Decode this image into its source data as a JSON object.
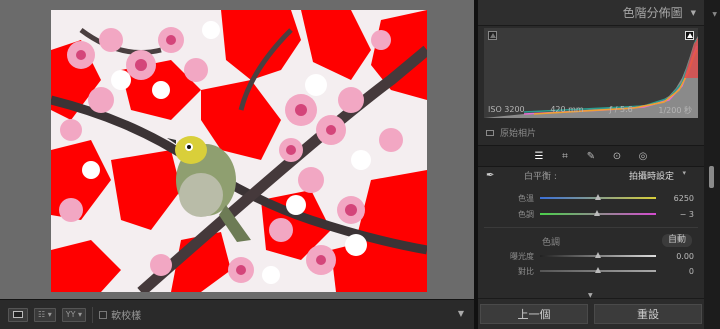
{
  "panel": {
    "title": "色階分佈圖",
    "collapse_icon": "triangle-down-icon"
  },
  "histogram": {
    "iso": "ISO 3200",
    "focal_length": "420 mm",
    "aperture": "ƒ / 5.6",
    "shutter": "1/200 秒",
    "original_photo_label": "原始相片"
  },
  "tools": [
    "sliders-icon",
    "crop-icon",
    "brush-icon",
    "redeye-icon",
    "radial-icon"
  ],
  "basic": {
    "white_balance_label": "白平衡 :",
    "white_balance_value": "拍攝時設定",
    "temp_label": "色溫",
    "temp_value": "6250",
    "tint_label": "色調",
    "tint_value": "− 3",
    "tone_label": "色調",
    "auto_label": "自動",
    "exposure_label": "曝光度",
    "exposure_value": "0.00",
    "contrast_label": "對比",
    "contrast_value": "0"
  },
  "toolbar": {
    "softproof_label": "軟校樣",
    "grid_label": "☷ ▾",
    "compare_label": "YY ▾"
  },
  "buttons": {
    "previous": "上一個",
    "reset": "重設"
  },
  "colors": {
    "clipping_highlight": "#ff0000",
    "panel_bg": "#2a2a2a",
    "canvas_bg": "#6b6b6b"
  }
}
